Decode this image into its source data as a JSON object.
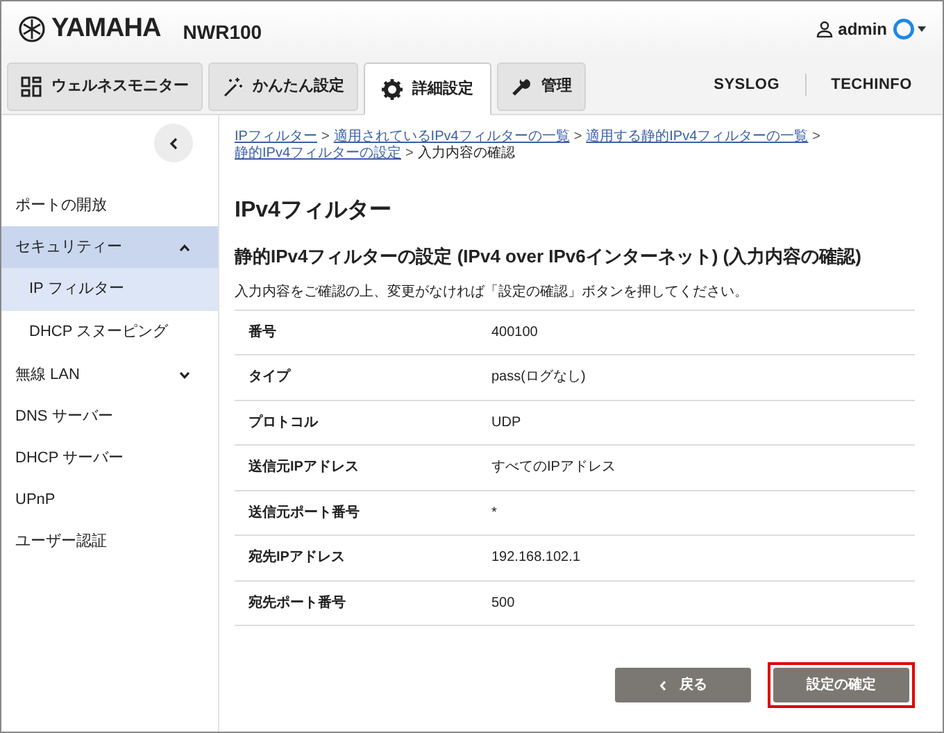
{
  "header": {
    "brand": "YAMAHA",
    "model": "NWR100",
    "user": "admin"
  },
  "tabs": [
    {
      "label": "ウェルネスモニター",
      "selected": false
    },
    {
      "label": "かんたん設定",
      "selected": false
    },
    {
      "label": "詳細設定",
      "selected": true
    },
    {
      "label": "管理",
      "selected": false
    }
  ],
  "top_links": [
    "SYSLOG",
    "TECHINFO"
  ],
  "sidebar": {
    "items": [
      {
        "label": "ポートの開放",
        "selected": false
      },
      {
        "label": "セキュリティー",
        "selected": false,
        "expanded": true,
        "children": [
          {
            "label": "IP フィルター",
            "selected": true
          },
          {
            "label": "DHCP スヌーピング",
            "selected": false
          }
        ]
      },
      {
        "label": "無線 LAN",
        "selected": false,
        "expanded": false
      },
      {
        "label": "DNS サーバー",
        "selected": false
      },
      {
        "label": "DHCP サーバー",
        "selected": false
      },
      {
        "label": "UPnP",
        "selected": false
      },
      {
        "label": "ユーザー認証",
        "selected": false
      }
    ]
  },
  "breadcrumb": [
    {
      "label": "IPフィルター",
      "kind": "link"
    },
    {
      "label": ">",
      "kind": "separator"
    },
    {
      "label": "適用されているIPv4フィルターの一覧",
      "kind": "link"
    },
    {
      "label": ">",
      "kind": "separator"
    },
    {
      "label": "適用する静的IPv4フィルターの一覧",
      "kind": "link"
    },
    {
      "label": ">",
      "kind": "separator"
    },
    {
      "label": "静的IPv4フィルターの設定",
      "kind": "link"
    },
    {
      "label": ">",
      "kind": "separator"
    },
    {
      "label": "入力内容の確認",
      "kind": "text"
    }
  ],
  "title": "IPv4フィルター",
  "subtitle": "静的IPv4フィルターの設定 (IPv4 over IPv6インターネット) (入力内容の確認)",
  "instruction": "入力内容をご確認の上、変更がなければ「設定の確認」ボタンを押してください。",
  "table": {
    "rows": [
      {
        "label": "番号",
        "value": "400100"
      },
      {
        "label": "タイプ",
        "value": "pass(ログなし)"
      },
      {
        "label": "プロトコル",
        "value": "UDP"
      },
      {
        "label": "送信元IPアドレス",
        "value": "すべてのIPアドレス"
      },
      {
        "label": "送信元ポート番号",
        "value": "*"
      },
      {
        "label": "宛先IPアドレス",
        "value": "192.168.102.1"
      },
      {
        "label": "宛先ポート番号",
        "value": "500"
      }
    ]
  },
  "buttons": [
    {
      "label": "戻る",
      "kind": "back",
      "highlighted": false
    },
    {
      "label": "設定の確定",
      "kind": "confirm",
      "highlighted": true
    }
  ]
}
